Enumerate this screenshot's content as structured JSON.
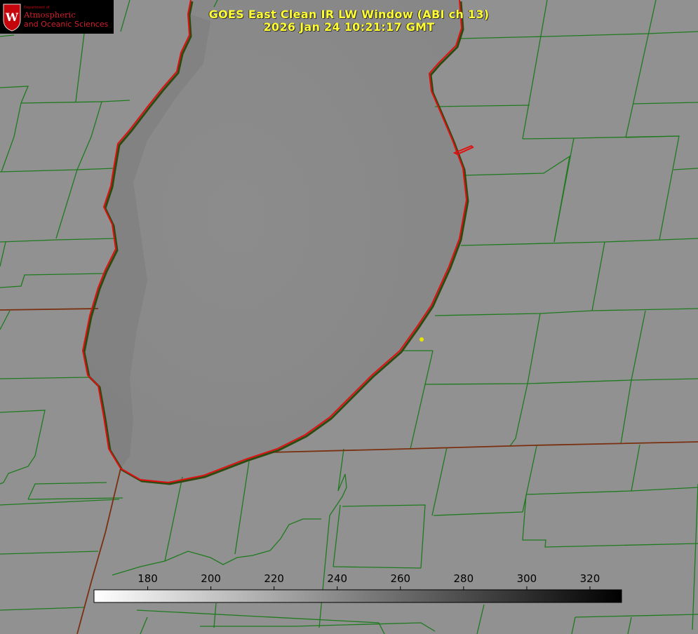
{
  "title": {
    "line1": "GOES East Clean IR LW Window (ABI ch 13)",
    "line2": "2026 Jan 24 10:21:17 GMT"
  },
  "logo": {
    "department": "Department of",
    "line1": "Atmospheric",
    "line2": "and Oceanic Sciences",
    "emblem": "uw-crest-icon"
  },
  "colorbar": {
    "ticks": [
      "180",
      "200",
      "220",
      "240",
      "260",
      "280",
      "300",
      "320"
    ],
    "min": 163,
    "max": 330,
    "colors": {
      "low": "#ffffff",
      "high": "#000000"
    }
  },
  "colors": {
    "county_lines": "#1e7a1e",
    "coast_red": "#e00000",
    "state_line": "#7a3010",
    "land": "#8e8e8e",
    "lake": "#8a8a8a",
    "marker": "#e6e600"
  }
}
